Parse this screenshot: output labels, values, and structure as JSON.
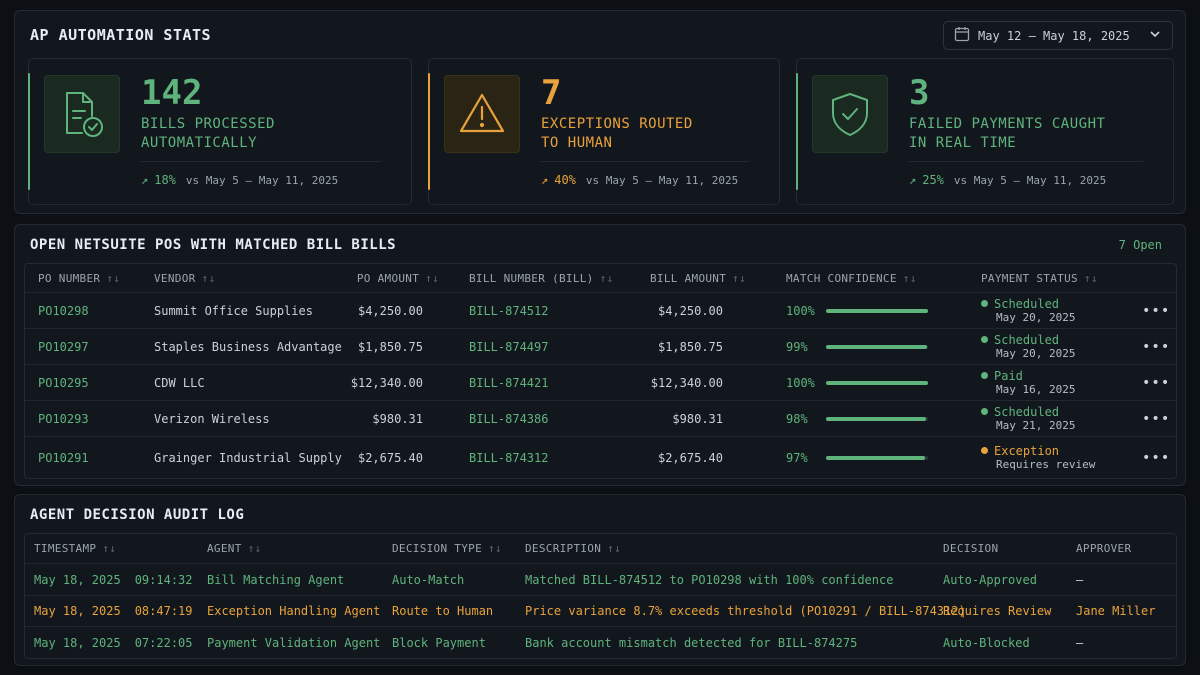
{
  "stats": {
    "title": "AP AUTOMATION STATS",
    "date_range": "May 12 – May 18, 2025",
    "cards": [
      {
        "value": "142",
        "label_line1": "BILLS PROCESSED",
        "label_line2": "AUTOMATICALLY",
        "change": "18%",
        "vs": "vs May 5 – May 11, 2025",
        "color": "#5fb37c",
        "icon": "document-check-icon"
      },
      {
        "value": "7",
        "label_line1": "EXCEPTIONS ROUTED",
        "label_line2": "TO HUMAN",
        "change": "40%",
        "vs": "vs May 5 – May 11, 2025",
        "color": "#e9a23b",
        "icon": "warning-triangle-icon"
      },
      {
        "value": "3",
        "label_line1": "FAILED PAYMENTS CAUGHT",
        "label_line2": "IN REAL TIME",
        "change": "25%",
        "vs": "vs May 5 – May 11, 2025",
        "color": "#5fb37c",
        "icon": "shield-check-icon"
      }
    ]
  },
  "pos": {
    "title": "OPEN NETSUITE POS WITH MATCHED BILL BILLS",
    "open_count": "7 Open",
    "columns": [
      "PO NUMBER",
      "VENDOR",
      "PO AMOUNT",
      "BILL NUMBER (BILL)",
      "BILL AMOUNT",
      "MATCH CONFIDENCE",
      "PAYMENT STATUS"
    ],
    "rows": [
      {
        "po": "PO10298",
        "vendor": "Summit Office Supplies",
        "po_amount": "$4,250.00",
        "bill": "BILL-874512",
        "bill_amount": "$4,250.00",
        "confidence": "100%",
        "confidence_value": 100,
        "status": "Scheduled",
        "status_detail": "May 20, 2025",
        "status_color": "#5fb37c"
      },
      {
        "po": "PO10297",
        "vendor": "Staples Business Advantage",
        "po_amount": "$1,850.75",
        "bill": "BILL-874497",
        "bill_amount": "$1,850.75",
        "confidence": "99%",
        "confidence_value": 99,
        "status": "Scheduled",
        "status_detail": "May 20, 2025",
        "status_color": "#5fb37c"
      },
      {
        "po": "PO10295",
        "vendor": "CDW LLC",
        "po_amount": "$12,340.00",
        "bill": "BILL-874421",
        "bill_amount": "$12,340.00",
        "confidence": "100%",
        "confidence_value": 100,
        "status": "Paid",
        "status_detail": "May 16, 2025",
        "status_color": "#5fb37c"
      },
      {
        "po": "PO10293",
        "vendor": "Verizon Wireless",
        "po_amount": "$980.31",
        "bill": "BILL-874386",
        "bill_amount": "$980.31",
        "confidence": "98%",
        "confidence_value": 98,
        "status": "Scheduled",
        "status_detail": "May 21, 2025",
        "status_color": "#5fb37c"
      },
      {
        "po": "PO10291",
        "vendor": "Grainger Industrial Supply",
        "po_amount": "$2,675.40",
        "bill": "BILL-874312",
        "bill_amount": "$2,675.40",
        "confidence": "97%",
        "confidence_value": 97,
        "status": "Exception",
        "status_detail": "Requires review",
        "status_color": "#e9a23b"
      }
    ]
  },
  "audit": {
    "title": "AGENT DECISION AUDIT LOG",
    "columns": [
      "TIMESTAMP",
      "AGENT",
      "DECISION TYPE",
      "DESCRIPTION",
      "DECISION",
      "APPROVER"
    ],
    "rows": [
      {
        "date": "May 18, 2025",
        "time": "09:14:32",
        "agent": "Bill Matching Agent",
        "type": "Auto-Match",
        "description": "Matched BILL-874512 to PO10298 with 100% confidence",
        "decision": "Auto-Approved",
        "approver": "—",
        "tone": "green"
      },
      {
        "date": "May 18, 2025",
        "time": "08:47:19",
        "agent": "Exception Handling Agent",
        "type": "Route to Human",
        "description": "Price variance 8.7% exceeds threshold (PO10291 / BILL-874312)",
        "decision": "Requires Review",
        "approver": "Jane Miller",
        "tone": "amber"
      },
      {
        "date": "May 18, 2025",
        "time": "07:22:05",
        "agent": "Payment Validation Agent",
        "type": "Block Payment",
        "description": "Bank account mismatch detected for BILL-874275",
        "decision": "Auto-Blocked",
        "approver": "—",
        "tone": "green"
      }
    ]
  }
}
